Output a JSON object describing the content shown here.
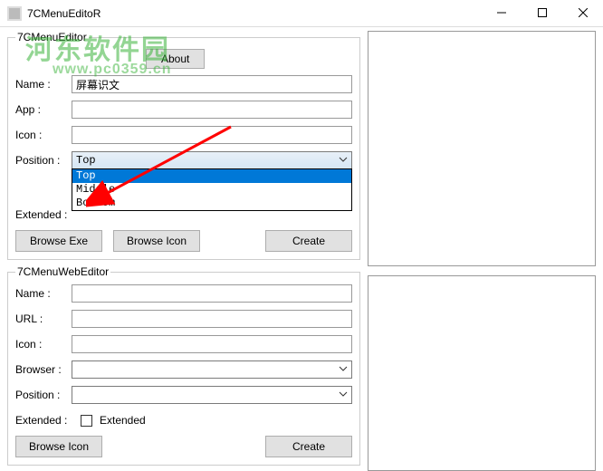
{
  "window": {
    "title": "7CMenuEditoR",
    "min_label": "Minimize",
    "max_label": "Maximize",
    "close_label": "Close"
  },
  "watermark": {
    "main": "河东软件园",
    "sub": "www.pc0359.cn"
  },
  "section1": {
    "legend": "7CMenuEditor",
    "about": "About",
    "name_label": "Name :",
    "name_value": "屏幕识文",
    "app_label": "App :",
    "app_value": "",
    "icon_label": "Icon :",
    "icon_value": "",
    "position_label": "Position :",
    "position_selected": "Top",
    "position_options": {
      "opt0": "Top",
      "opt1": "Middle",
      "opt2": "Bottom"
    },
    "extended_label": "Extended :",
    "browse_exe": "Browse Exe",
    "browse_icon": "Browse Icon",
    "create": "Create"
  },
  "section2": {
    "legend": "7CMenuWebEditor",
    "name_label": "Name :",
    "name_value": "",
    "url_label": "URL :",
    "url_value": "",
    "icon_label": "Icon :",
    "icon_value": "",
    "browser_label": "Browser :",
    "browser_value": "",
    "position_label": "Position :",
    "position_value": "",
    "extended_label": "Extended :",
    "extended_text": "Extended",
    "browse_icon": "Browse Icon",
    "create": "Create"
  }
}
